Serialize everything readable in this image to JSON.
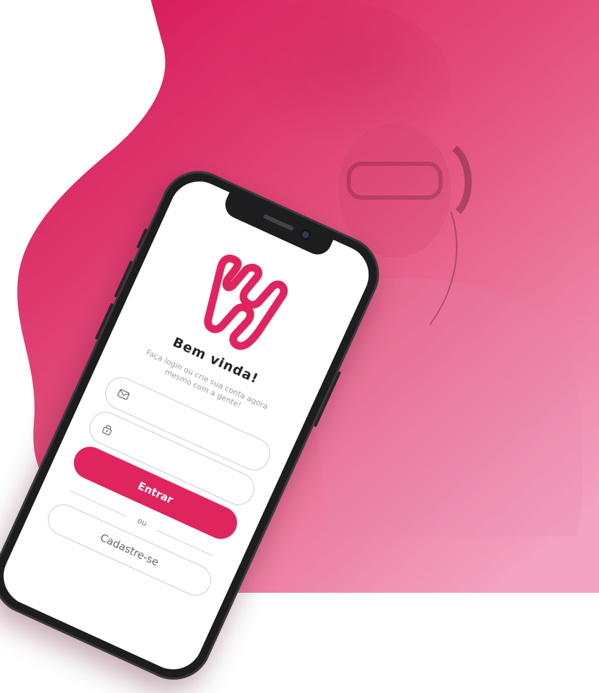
{
  "app": {
    "title": "Bem vinda!",
    "subtitle": "Faça login ou crie sua conta agora mesmo com a gente!"
  },
  "form": {
    "email_icon": "envelope-icon",
    "password_icon": "lock-icon",
    "email_placeholder": "",
    "password_placeholder": ""
  },
  "actions": {
    "login_label": "Entrar",
    "divider_label": "ou",
    "signup_label": "Cadastre-se"
  },
  "colors": {
    "brand": "#e0245e",
    "background_gradient_start": "#d81c5c",
    "background_gradient_end": "#f3a3c0",
    "text": "#222222",
    "muted": "#9a9a9a"
  }
}
